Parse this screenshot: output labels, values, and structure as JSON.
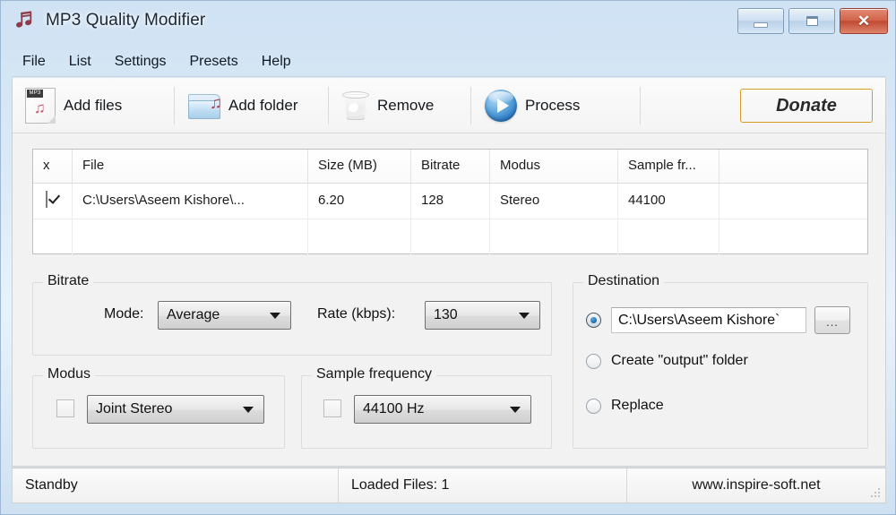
{
  "window": {
    "title": "MP3 Quality Modifier",
    "icon": "music-note-icon",
    "controls": {
      "minimize": "minimize-icon",
      "maximize": "maximize-icon",
      "close": "✕"
    }
  },
  "menu": {
    "items": [
      {
        "label": "File"
      },
      {
        "label": "List"
      },
      {
        "label": "Settings"
      },
      {
        "label": "Presets"
      },
      {
        "label": "Help"
      }
    ]
  },
  "toolbar": {
    "add_files": {
      "label": "Add files",
      "icon": "mp3-file-icon"
    },
    "add_folder": {
      "label": "Add folder",
      "icon": "music-folder-icon"
    },
    "remove": {
      "label": "Remove",
      "icon": "recycle-bin-icon"
    },
    "process": {
      "label": "Process",
      "icon": "play-circle-icon"
    },
    "donate": {
      "label": "Donate"
    }
  },
  "filelist": {
    "columns": [
      "x",
      "File",
      "Size  (MB)",
      "Bitrate",
      "Modus",
      "Sample fr...",
      ""
    ],
    "rows": [
      {
        "checked": true,
        "file": "C:\\Users\\Aseem Kishore\\...",
        "size": "6.20",
        "bitrate": "128",
        "modus": "Stereo",
        "sample_frequency": "44100"
      }
    ]
  },
  "bitrate": {
    "legend": "Bitrate",
    "mode_label": "Mode:",
    "mode_value": "Average",
    "rate_label": "Rate (kbps):",
    "rate_value": "130"
  },
  "modus": {
    "legend": "Modus",
    "enabled": false,
    "value": "Joint Stereo"
  },
  "sample_frequency": {
    "legend": "Sample frequency",
    "enabled": false,
    "value": "44100 Hz"
  },
  "destination": {
    "legend": "Destination",
    "options": [
      {
        "label": "",
        "selected": true,
        "kind": "path"
      },
      {
        "label": "Create \"output\" folder",
        "selected": false,
        "kind": "radio"
      },
      {
        "label": "Replace",
        "selected": false,
        "kind": "radio"
      }
    ],
    "path_value": "C:\\Users\\Aseem Kishore`",
    "browse_label": "..."
  },
  "statusbar": {
    "status": "Standby",
    "loaded_files": "Loaded Files: 1",
    "website": "www.inspire-soft.net"
  },
  "colors": {
    "titlebar_glass": "#cfe2f3",
    "accent_donate": "#f0a92f",
    "close_button": "#bf4a32",
    "process_blue": "#2b7ac4",
    "note_red": "#a8425c",
    "client_bg": "#f2f2f2"
  }
}
